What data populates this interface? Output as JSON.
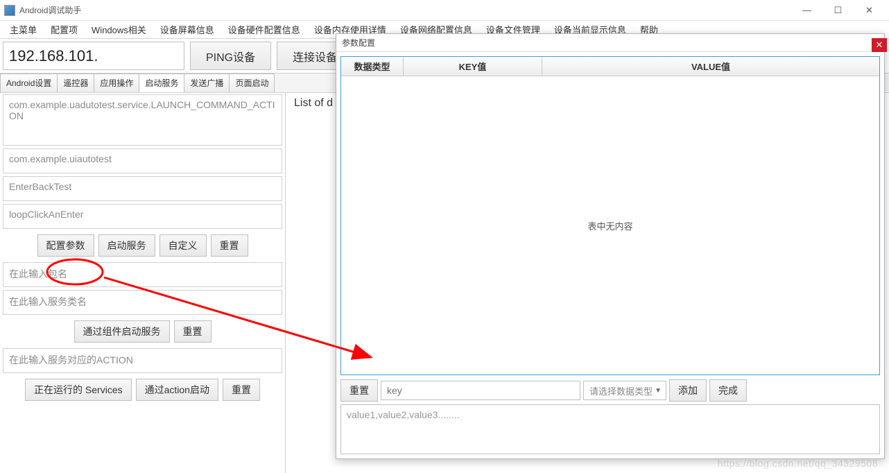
{
  "window": {
    "title": "Android调试助手"
  },
  "menu": {
    "items": [
      "主菜单",
      "配置项",
      "Windows相关",
      "设备屏幕信息",
      "设备硬件配置信息",
      "设备内存使用详情",
      "设备网络配置信息",
      "设备文件管理",
      "设备当前显示信息",
      "帮助"
    ]
  },
  "ip_row": {
    "ip_value": "192.168.101.",
    "ping_label": "PING设备",
    "connect_label": "连接设备"
  },
  "tabs": {
    "items": [
      "Android设置",
      "遥控器",
      "应用操作",
      "启动服务",
      "发送广播",
      "页面启动"
    ],
    "active_index": 3
  },
  "left": {
    "box1": "com.example.uadutotest.service.LAUNCH_COMMAND_ACTION",
    "box2": "com.example.uiautotest",
    "box3": "EnterBackTest",
    "box4": "loopClickAnEnter",
    "row1": {
      "config": "配置参数",
      "start": "启动服务",
      "custom": "自定义",
      "reset": "重置"
    },
    "pkg_placeholder": "在此输入包名",
    "svc_placeholder": "在此输入服务类名",
    "row2": {
      "start_by_component": "通过组件启动服务",
      "reset": "重置"
    },
    "action_placeholder": "在此输入服务对应的ACTION",
    "row3": {
      "running_services": "正在运行的 Services",
      "start_by_action": "通过action启动",
      "reset": "重置"
    }
  },
  "right": {
    "list_header": "List of d"
  },
  "dialog": {
    "title": "参数配置",
    "col_type": "数据类型",
    "col_key": "KEY值",
    "col_value": "VALUE值",
    "empty_text": "表中无内容",
    "reset_label": "重置",
    "key_placeholder": "key",
    "combo_placeholder": "请选择数据类型",
    "add_label": "添加",
    "done_label": "完成",
    "value_placeholder": "value1,value2,value3........"
  },
  "watermark": "https://blog.csdn.net/qq_34329508"
}
